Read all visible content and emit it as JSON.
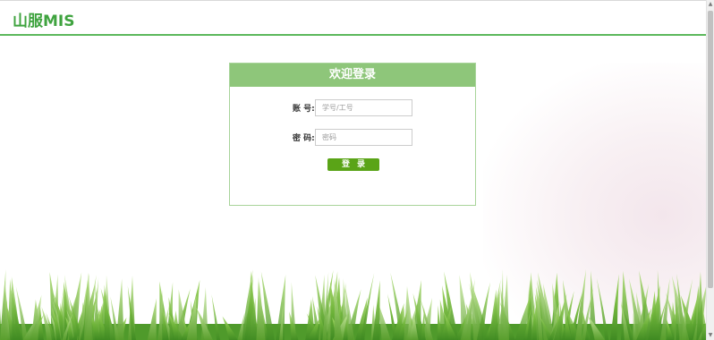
{
  "header": {
    "brand": "山服MIS"
  },
  "login": {
    "title": "欢迎登录",
    "account_label": "账 号:",
    "account_placeholder": "学号/工号",
    "password_label": "密 码:",
    "password_placeholder": "密码",
    "submit_label": "登录"
  },
  "colors": {
    "brand": "#3fa33f",
    "header_rule": "#5cb85c",
    "panel_header": "#8ec67a",
    "panel_border": "#a8d49a",
    "button": "#5aa417"
  },
  "icons": {
    "scroll_up": "triangle-up-icon",
    "scroll_down": "triangle-down-icon"
  }
}
